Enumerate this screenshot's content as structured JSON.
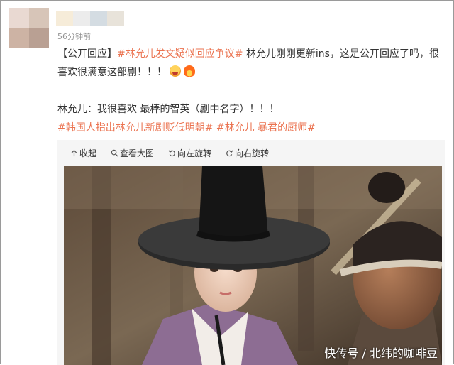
{
  "post": {
    "time": "56分钟前",
    "line1_prefix": "【公开回应】",
    "line1_tag": "#林允儿发文疑似回应争议#",
    "line1_rest": " 林允儿刚刚更新ins，这是公开回应了吗，很",
    "line2_text": "喜欢很满意这部剧！！！",
    "line3_text": "林允儿：我很喜欢 最棒的智英（剧中名字）！！！",
    "tag2": "#韩国人指出林允儿新剧贬低明朝#",
    "tag3": "#林允儿 暴君的厨师#"
  },
  "toolbar": {
    "collapse": "收起",
    "view_large": "查看大图",
    "rotate_left": "向左旋转",
    "rotate_right": "向右旋转"
  },
  "photo": {
    "watermark": "快传号 / 北纬的咖啡豆"
  },
  "colors": {
    "tag": "#eb7350",
    "time": "#939393",
    "frame_border": "#9a9a9a"
  }
}
